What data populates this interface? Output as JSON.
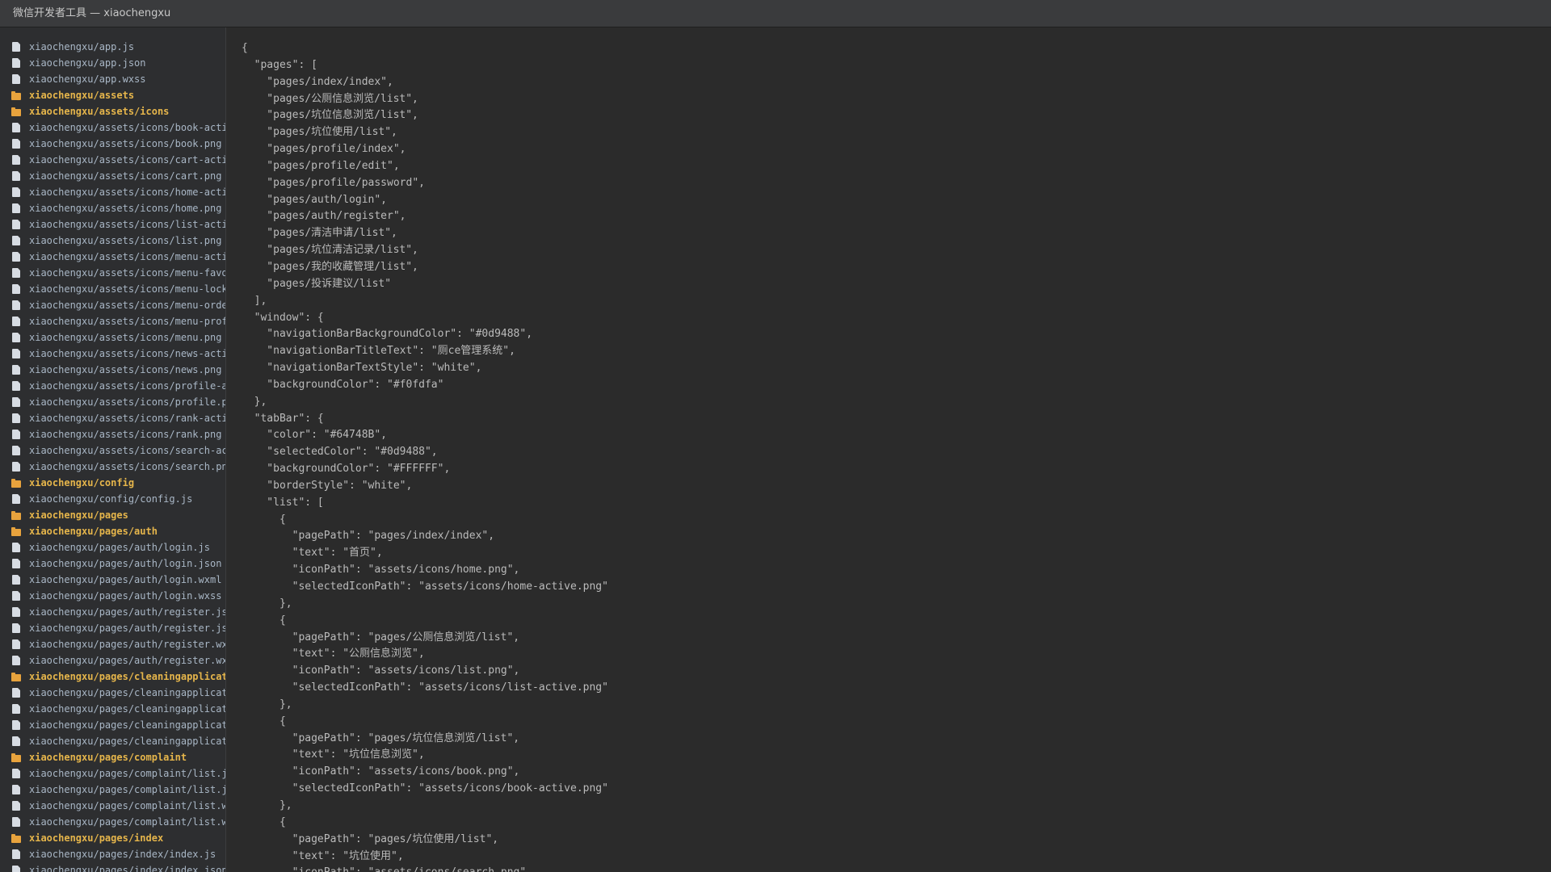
{
  "window": {
    "title": "微信开发者工具 — xiaochengxu"
  },
  "colors": {
    "titlebar": "#3a3b3d",
    "sidebar": "#2d2e30",
    "editor": "#2b2b2b",
    "file_text": "#a9b7c6",
    "folder_text": "#e5b54b",
    "code_text": "#bbbbbb"
  },
  "sidebar": {
    "items": [
      {
        "type": "file",
        "label": "xiaochengxu/app.js"
      },
      {
        "type": "file",
        "label": "xiaochengxu/app.json"
      },
      {
        "type": "file",
        "label": "xiaochengxu/app.wxss"
      },
      {
        "type": "folder",
        "label": "xiaochengxu/assets"
      },
      {
        "type": "folder",
        "label": "xiaochengxu/assets/icons"
      },
      {
        "type": "file",
        "label": "xiaochengxu/assets/icons/book-acti"
      },
      {
        "type": "file",
        "label": "xiaochengxu/assets/icons/book.png"
      },
      {
        "type": "file",
        "label": "xiaochengxu/assets/icons/cart-acti"
      },
      {
        "type": "file",
        "label": "xiaochengxu/assets/icons/cart.png"
      },
      {
        "type": "file",
        "label": "xiaochengxu/assets/icons/home-acti"
      },
      {
        "type": "file",
        "label": "xiaochengxu/assets/icons/home.png"
      },
      {
        "type": "file",
        "label": "xiaochengxu/assets/icons/list-acti"
      },
      {
        "type": "file",
        "label": "xiaochengxu/assets/icons/list.png"
      },
      {
        "type": "file",
        "label": "xiaochengxu/assets/icons/menu-acti"
      },
      {
        "type": "file",
        "label": "xiaochengxu/assets/icons/menu-favo"
      },
      {
        "type": "file",
        "label": "xiaochengxu/assets/icons/menu-lock"
      },
      {
        "type": "file",
        "label": "xiaochengxu/assets/icons/menu-orde"
      },
      {
        "type": "file",
        "label": "xiaochengxu/assets/icons/menu-prof"
      },
      {
        "type": "file",
        "label": "xiaochengxu/assets/icons/menu.png"
      },
      {
        "type": "file",
        "label": "xiaochengxu/assets/icons/news-acti"
      },
      {
        "type": "file",
        "label": "xiaochengxu/assets/icons/news.png"
      },
      {
        "type": "file",
        "label": "xiaochengxu/assets/icons/profile-a"
      },
      {
        "type": "file",
        "label": "xiaochengxu/assets/icons/profile.p"
      },
      {
        "type": "file",
        "label": "xiaochengxu/assets/icons/rank-acti"
      },
      {
        "type": "file",
        "label": "xiaochengxu/assets/icons/rank.png"
      },
      {
        "type": "file",
        "label": "xiaochengxu/assets/icons/search-ac"
      },
      {
        "type": "file",
        "label": "xiaochengxu/assets/icons/search.pn"
      },
      {
        "type": "folder",
        "label": "xiaochengxu/config"
      },
      {
        "type": "file",
        "label": "xiaochengxu/config/config.js"
      },
      {
        "type": "folder",
        "label": "xiaochengxu/pages"
      },
      {
        "type": "folder",
        "label": "xiaochengxu/pages/auth"
      },
      {
        "type": "file",
        "label": "xiaochengxu/pages/auth/login.js"
      },
      {
        "type": "file",
        "label": "xiaochengxu/pages/auth/login.json"
      },
      {
        "type": "file",
        "label": "xiaochengxu/pages/auth/login.wxml"
      },
      {
        "type": "file",
        "label": "xiaochengxu/pages/auth/login.wxss"
      },
      {
        "type": "file",
        "label": "xiaochengxu/pages/auth/register.js"
      },
      {
        "type": "file",
        "label": "xiaochengxu/pages/auth/register.js"
      },
      {
        "type": "file",
        "label": "xiaochengxu/pages/auth/register.wx"
      },
      {
        "type": "file",
        "label": "xiaochengxu/pages/auth/register.wx"
      },
      {
        "type": "folder",
        "label": "xiaochengxu/pages/cleaningapplicat"
      },
      {
        "type": "file",
        "label": "xiaochengxu/pages/cleaningapplicat"
      },
      {
        "type": "file",
        "label": "xiaochengxu/pages/cleaningapplicat"
      },
      {
        "type": "file",
        "label": "xiaochengxu/pages/cleaningapplicat"
      },
      {
        "type": "file",
        "label": "xiaochengxu/pages/cleaningapplicat"
      },
      {
        "type": "folder",
        "label": "xiaochengxu/pages/complaint"
      },
      {
        "type": "file",
        "label": "xiaochengxu/pages/complaint/list.j"
      },
      {
        "type": "file",
        "label": "xiaochengxu/pages/complaint/list.j"
      },
      {
        "type": "file",
        "label": "xiaochengxu/pages/complaint/list.w"
      },
      {
        "type": "file",
        "label": "xiaochengxu/pages/complaint/list.w"
      },
      {
        "type": "folder",
        "label": "xiaochengxu/pages/index"
      },
      {
        "type": "file",
        "label": "xiaochengxu/pages/index/index.js"
      },
      {
        "type": "file",
        "label": "xiaochengxu/pages/index/index.json"
      }
    ]
  },
  "editor": {
    "lines": [
      "{",
      "  \"pages\": [",
      "    \"pages/index/index\",",
      "    \"pages/公厕信息浏览/list\",",
      "    \"pages/坑位信息浏览/list\",",
      "    \"pages/坑位使用/list\",",
      "    \"pages/profile/index\",",
      "    \"pages/profile/edit\",",
      "    \"pages/profile/password\",",
      "    \"pages/auth/login\",",
      "    \"pages/auth/register\",",
      "    \"pages/清洁申请/list\",",
      "    \"pages/坑位清洁记录/list\",",
      "    \"pages/我的收藏管理/list\",",
      "    \"pages/投诉建议/list\"",
      "  ],",
      "  \"window\": {",
      "    \"navigationBarBackgroundColor\": \"#0d9488\",",
      "    \"navigationBarTitleText\": \"厕ce管理系统\",",
      "    \"navigationBarTextStyle\": \"white\",",
      "    \"backgroundColor\": \"#f0fdfa\"",
      "  },",
      "  \"tabBar\": {",
      "    \"color\": \"#64748B\",",
      "    \"selectedColor\": \"#0d9488\",",
      "    \"backgroundColor\": \"#FFFFFF\",",
      "    \"borderStyle\": \"white\",",
      "    \"list\": [",
      "      {",
      "        \"pagePath\": \"pages/index/index\",",
      "        \"text\": \"首页\",",
      "        \"iconPath\": \"assets/icons/home.png\",",
      "        \"selectedIconPath\": \"assets/icons/home-active.png\"",
      "      },",
      "      {",
      "        \"pagePath\": \"pages/公厕信息浏览/list\",",
      "        \"text\": \"公厕信息浏览\",",
      "        \"iconPath\": \"assets/icons/list.png\",",
      "        \"selectedIconPath\": \"assets/icons/list-active.png\"",
      "      },",
      "      {",
      "        \"pagePath\": \"pages/坑位信息浏览/list\",",
      "        \"text\": \"坑位信息浏览\",",
      "        \"iconPath\": \"assets/icons/book.png\",",
      "        \"selectedIconPath\": \"assets/icons/book-active.png\"",
      "      },",
      "      {",
      "        \"pagePath\": \"pages/坑位使用/list\",",
      "        \"text\": \"坑位使用\",",
      "        \"iconPath\": \"assets/icons/search.png\","
    ]
  }
}
